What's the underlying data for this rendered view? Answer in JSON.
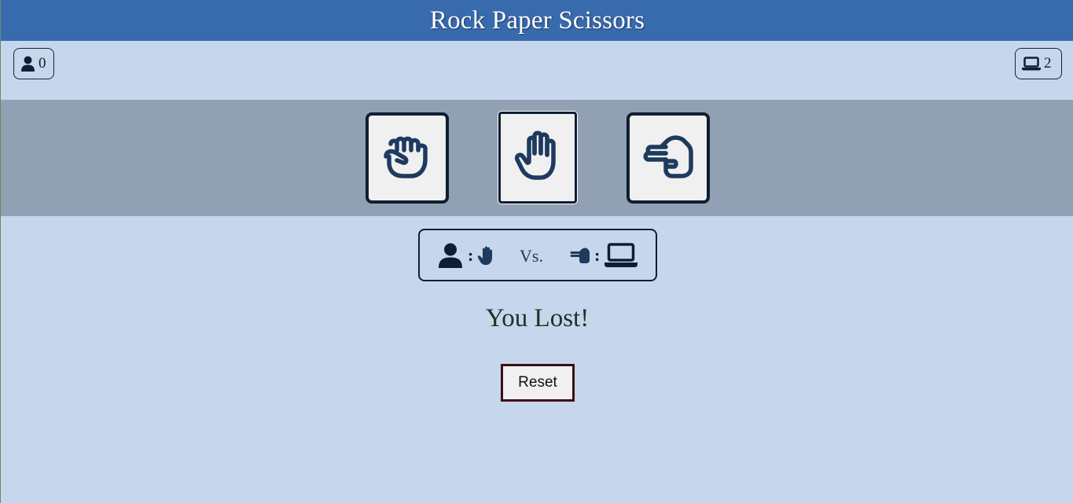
{
  "app": {
    "title": "Rock Paper Scissors"
  },
  "scores": {
    "player": {
      "icon": "user-icon",
      "value": "0"
    },
    "computer": {
      "icon": "laptop-icon",
      "value": "2"
    }
  },
  "choices": [
    {
      "id": "rock",
      "icon": "hand-fist-icon",
      "selected": false
    },
    {
      "id": "paper",
      "icon": "hand-open-icon",
      "selected": true
    },
    {
      "id": "scissors",
      "icon": "hand-scissors-icon",
      "selected": false
    }
  ],
  "matchup": {
    "player_icon": "user-icon",
    "player_colon": ":",
    "player_choice_icon": "hand-open-icon",
    "vs_label": "Vs.",
    "computer_choice_icon": "hand-scissors-icon",
    "computer_colon": ":",
    "computer_icon": "laptop-icon"
  },
  "result": {
    "message": "You Lost!"
  },
  "controls": {
    "reset_label": "Reset"
  },
  "colors": {
    "header": "#386bae",
    "page_background": "#c6d6ed",
    "choices_band": "#91a1b3",
    "icon_dark": "#1e3a5f",
    "result_text": "#1b3320"
  }
}
